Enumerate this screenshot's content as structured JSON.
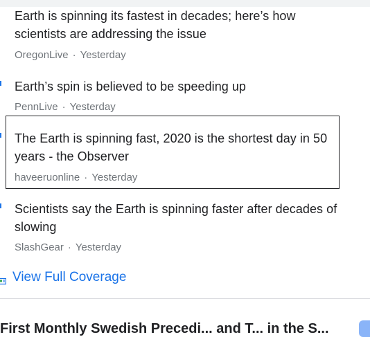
{
  "articles": [
    {
      "title": "Earth is spinning its fastest in decades; here’s how scientists are addressing the issue",
      "source": "OregonLive",
      "time": "Yesterday"
    },
    {
      "title": "Earth’s spin is believed to be speeding up",
      "source": "PennLive",
      "time": "Yesterday"
    },
    {
      "title": "The Earth is spinning fast, 2020 is the shortest day in 50 years - the Observer",
      "source": "haveeruonline",
      "time": "Yesterday"
    },
    {
      "title": "Scientists say the Earth is spinning faster after decades of slowing",
      "source": "SlashGear",
      "time": "Yesterday"
    }
  ],
  "meta_separator": "·",
  "coverage": {
    "label": "View Full Coverage",
    "icon": "full-coverage-icon"
  },
  "next_story": {
    "title": "First Monthly Swedish Precedi... and T... in the S..."
  },
  "colors": {
    "link": "#1a73e8",
    "text": "#202124",
    "meta": "#70757a",
    "divider": "#dadce0"
  }
}
